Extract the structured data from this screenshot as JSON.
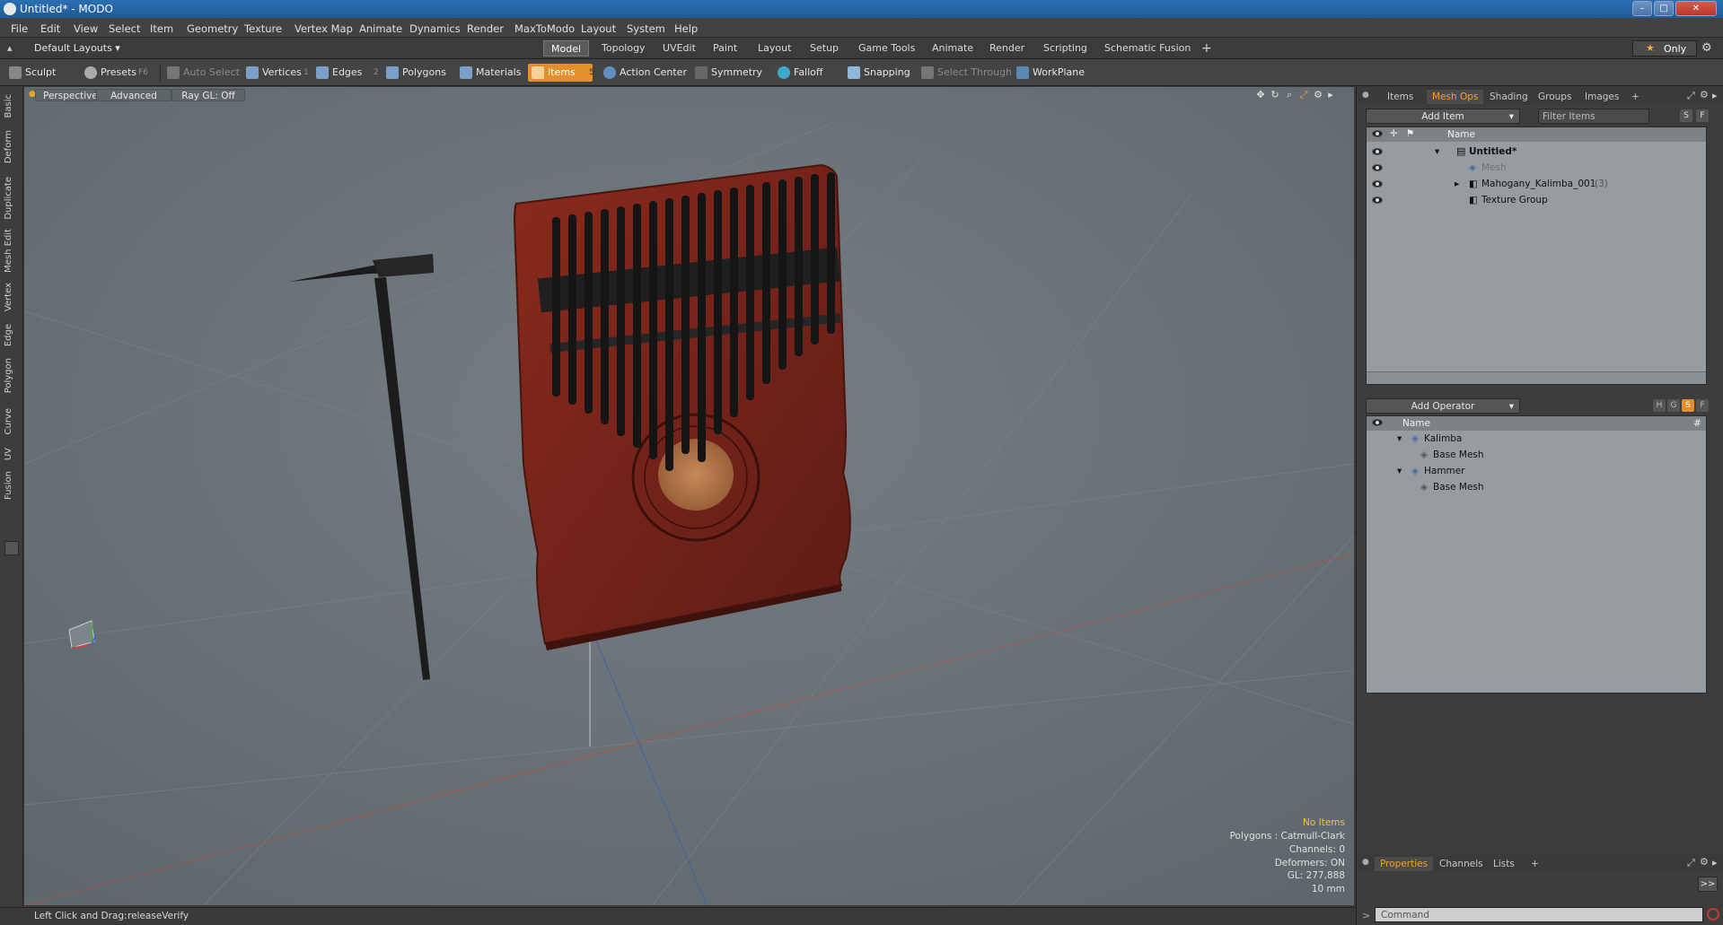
{
  "window": {
    "title": "Untitled* - MODO",
    "min": "–",
    "max": "□",
    "close": "✕"
  },
  "menu": [
    "File",
    "Edit",
    "View",
    "Select",
    "Item",
    "Geometry",
    "Texture",
    "Vertex Map",
    "Animate",
    "Dynamics",
    "Render",
    "MaxToModo",
    "Layout",
    "System",
    "Help"
  ],
  "layout_selector": "Default Layouts ▾",
  "tabs": [
    "Model",
    "Topology",
    "UVEdit",
    "Paint",
    "Layout",
    "Setup",
    "Game Tools",
    "Animate",
    "Render",
    "Scripting",
    "Schematic Fusion"
  ],
  "tab_add": "+",
  "only_label": "Only",
  "toolbar": {
    "sculpt": "Sculpt",
    "presets": "Presets",
    "presets_key": "F6",
    "auto_select": "Auto Select",
    "vertices": "Vertices",
    "vertices_key": "1",
    "edges": "Edges",
    "edges_key": "2",
    "polygons": "Polygons",
    "materials": "Materials",
    "items": "Items",
    "items_key": "5",
    "action_center": "Action Center",
    "symmetry": "Symmetry",
    "falloff": "Falloff",
    "snapping": "Snapping",
    "select_through": "Select Through",
    "workplane": "WorkPlane"
  },
  "side_tabs": [
    "Basic",
    "Deform",
    "Duplicate",
    "Mesh Edit",
    "Vertex",
    "Edge",
    "Polygon",
    "Curve",
    "UV",
    "Fusion"
  ],
  "viewport": {
    "view": "Perspective",
    "shading": "Advanced",
    "raygl": "Ray GL: Off"
  },
  "hud": {
    "selection": "No Items",
    "polygons": "Polygons : Catmull-Clark",
    "channels": "Channels: 0",
    "deformers": "Deformers: ON",
    "gl": "GL: 277,888",
    "scale": "10 mm"
  },
  "status": {
    "hint": "Left Click and Drag:",
    "action": "releaseVerify"
  },
  "item_tabs": [
    "Items",
    "Mesh Ops",
    "Shading",
    "Groups",
    "Images"
  ],
  "item_tabs_active": "Mesh Ops",
  "item_list": {
    "add_item": "Add Item",
    "filter_placeholder": "Filter Items",
    "s": "S",
    "f": "F",
    "col_name": "Name",
    "rows": [
      {
        "label": "Untitled*",
        "indent": 0
      },
      {
        "label": "Mesh",
        "indent": 1
      },
      {
        "label": "Mahogany_Kalimba_001",
        "count": "(3)",
        "indent": 1
      },
      {
        "label": "Texture Group",
        "indent": 1
      }
    ]
  },
  "operators": {
    "add_operator": "Add Operator",
    "h": "H",
    "g": "G",
    "s": "S",
    "f": "F",
    "col_name": "Name",
    "col_hash": "#",
    "rows": [
      {
        "label": "Kalimba",
        "indent": 0
      },
      {
        "label": "Base Mesh",
        "indent": 1
      },
      {
        "label": "Hammer",
        "indent": 0
      },
      {
        "label": "Base Mesh",
        "indent": 1
      }
    ]
  },
  "bottom_tabs": [
    "Properties",
    "Channels",
    "Lists"
  ],
  "bottom_tabs_active": "Properties",
  "command": {
    "placeholder": "Command",
    "expand": ">>"
  },
  "colors": {
    "accent": "#e38f2b",
    "viewport": "#6b7479",
    "kalimba_wood": "#7a2418",
    "tines": "#1a1a1a"
  }
}
